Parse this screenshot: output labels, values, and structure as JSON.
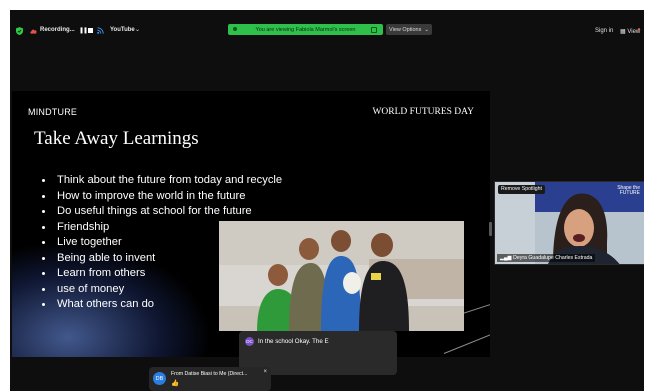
{
  "toolbar": {
    "recording_label": "Recording...",
    "youtube_label": "YouTube",
    "chevron": "⌄",
    "pause_glyph": "❚❚",
    "banner_text": "You are viewing Fabiola Marmol's screen",
    "view_options_label": "View Options",
    "view_options_chevron": "⌄",
    "sign_in_label": "Sign in",
    "view_label": "View"
  },
  "slide": {
    "logo": "MINDTURE",
    "event": "WORLD FUTURES DAY",
    "title": "Take Away Learnings",
    "bullets": [
      "Think about the future from today and recycle",
      "How to improve the world in the future",
      "Do useful things at school for the future",
      "Friendship",
      "Live together",
      "Being able to invent",
      "Learn from others",
      "use of money",
      "What others can do"
    ]
  },
  "spotlight": {
    "remove_label": "Remove Spotlight",
    "participant_name": "Deyra Guadalupe Charles Estrada",
    "logo_line1": "Shape the",
    "logo_line2": "FUTURE"
  },
  "chat": {
    "avatar_initials": "DC",
    "message": "In the school Okay. The E"
  },
  "dm": {
    "avatar_initials": "DB",
    "from_text": "From Datise Biasi to Me (Direct...",
    "emoji": "👍",
    "close": "×"
  },
  "colors": {
    "banner_green": "#2fbf4b",
    "app_background": "#0e0e0e",
    "chat_avatar": "#7a4fc7",
    "dm_avatar": "#2a7de1",
    "shield_green": "#2ecc40",
    "record_red": "#e0524a"
  },
  "icons": [
    "shield-icon",
    "cloud-record-icon",
    "pause-icon",
    "stop-icon",
    "live-stream-icon",
    "chevron-down-icon",
    "close-icon",
    "thumbs-up-icon"
  ]
}
